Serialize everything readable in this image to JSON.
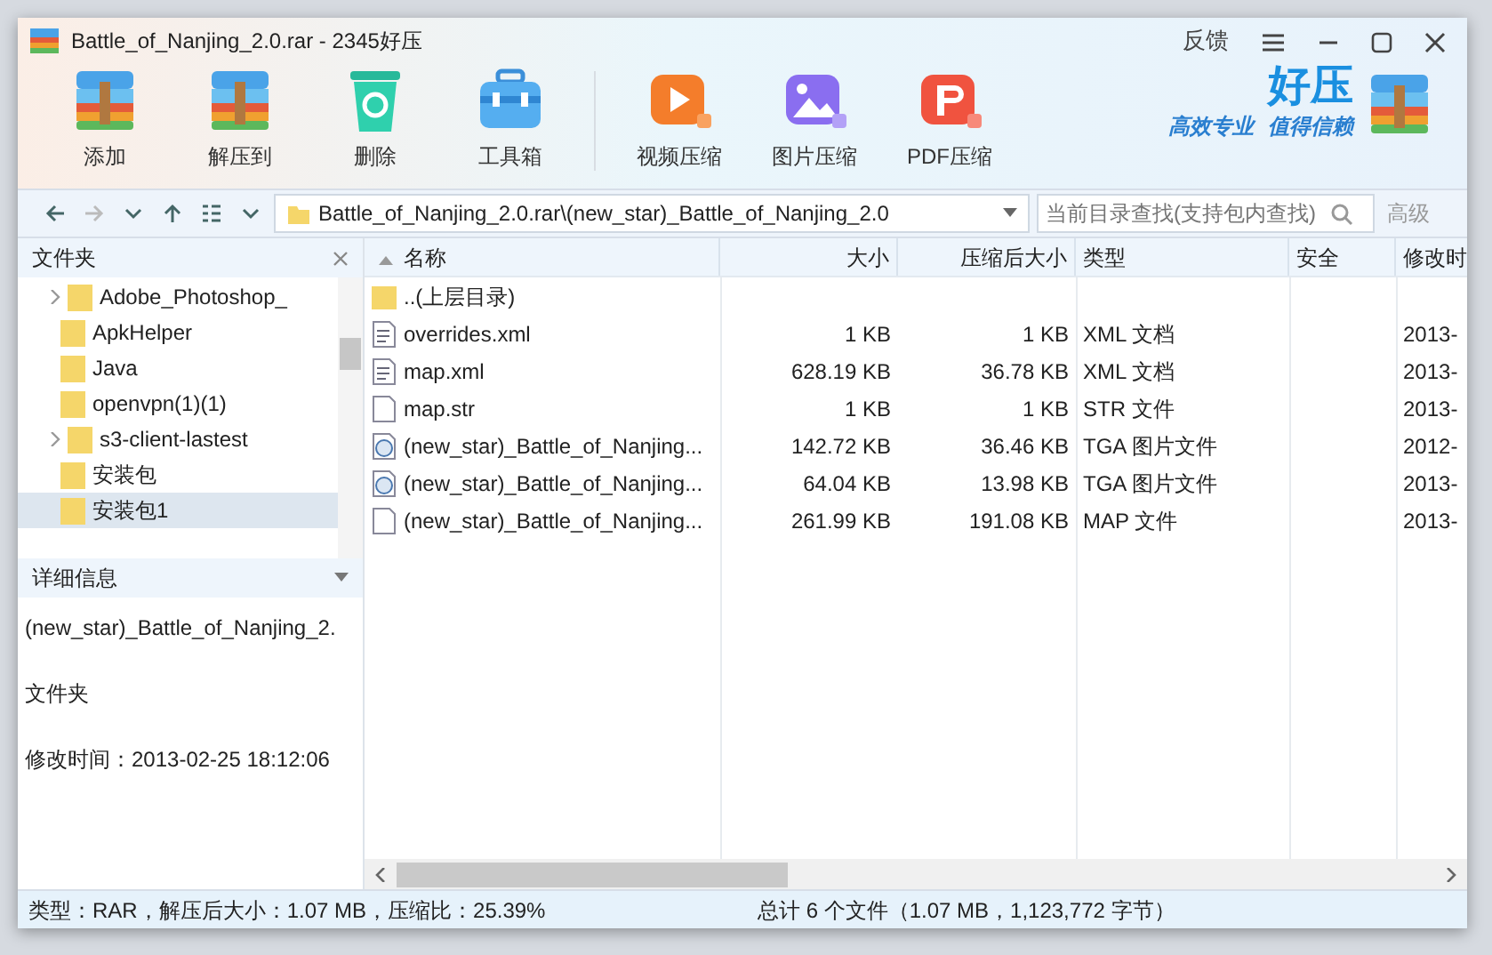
{
  "window": {
    "title": "Battle_of_Nanjing_2.0.rar - 2345好压",
    "feedback": "反馈"
  },
  "toolbar": {
    "groups": [
      [
        {
          "label": "添加",
          "kind": "add"
        },
        {
          "label": "解压到",
          "kind": "extract"
        },
        {
          "label": "删除",
          "kind": "delete"
        },
        {
          "label": "工具箱",
          "kind": "toolbox"
        }
      ],
      [
        {
          "label": "视频压缩",
          "kind": "video"
        },
        {
          "label": "图片压缩",
          "kind": "image"
        },
        {
          "label": "PDF压缩",
          "kind": "pdf"
        }
      ]
    ]
  },
  "logo": {
    "title": "好压",
    "slogan_1": "高效专业",
    "slogan_2": "值得信赖"
  },
  "address_bar": {
    "path": "Battle_of_Nanjing_2.0.rar\\(new_star)_Battle_of_Nanjing_2.0",
    "search_placeholder": "当前目录查找(支持包内查找)",
    "advanced": "高级"
  },
  "folder_panel": {
    "title": "文件夹",
    "items": [
      {
        "label": "Adobe_Photoshop_",
        "expandable": true,
        "selected": false
      },
      {
        "label": "ApkHelper",
        "expandable": false,
        "selected": false
      },
      {
        "label": "Java",
        "expandable": false,
        "selected": false
      },
      {
        "label": "openvpn(1)(1)",
        "expandable": false,
        "selected": false
      },
      {
        "label": "s3-client-lastest",
        "expandable": true,
        "selected": false
      },
      {
        "label": "安装包",
        "expandable": false,
        "selected": false
      },
      {
        "label": "安装包1",
        "expandable": false,
        "selected": true
      }
    ]
  },
  "details_panel": {
    "title": "详细信息",
    "name": "(new_star)_Battle_of_Nanjing_2.",
    "type": "文件夹",
    "modified": "修改时间：2013-02-25 18:12:06"
  },
  "table": {
    "columns": [
      {
        "label": "名称",
        "sorted": true
      },
      {
        "label": "大小",
        "sorted": false
      },
      {
        "label": "压缩后大小",
        "sorted": false
      },
      {
        "label": "类型",
        "sorted": false
      },
      {
        "label": "安全",
        "sorted": false
      },
      {
        "label": "修改时",
        "sorted": false
      }
    ],
    "rows": [
      {
        "kind": "folder",
        "name": "..(上层目录)",
        "size": "",
        "packed": "",
        "type": "",
        "modified": ""
      },
      {
        "kind": "xml",
        "name": "overrides.xml",
        "size": "1 KB",
        "packed": "1 KB",
        "type": "XML 文档",
        "modified": "2013-"
      },
      {
        "kind": "xml",
        "name": "map.xml",
        "size": "628.19 KB",
        "packed": "36.78 KB",
        "type": "XML 文档",
        "modified": "2013-"
      },
      {
        "kind": "file",
        "name": "map.str",
        "size": "1 KB",
        "packed": "1 KB",
        "type": "STR 文件",
        "modified": "2013-"
      },
      {
        "kind": "tga",
        "name": "(new_star)_Battle_of_Nanjing...",
        "size": "142.72 KB",
        "packed": "36.46 KB",
        "type": "TGA 图片文件",
        "modified": "2012-"
      },
      {
        "kind": "tga",
        "name": "(new_star)_Battle_of_Nanjing...",
        "size": "64.04 KB",
        "packed": "13.98 KB",
        "type": "TGA 图片文件",
        "modified": "2013-"
      },
      {
        "kind": "file",
        "name": "(new_star)_Battle_of_Nanjing...",
        "size": "261.99 KB",
        "packed": "191.08 KB",
        "type": "MAP 文件",
        "modified": "2013-"
      }
    ]
  },
  "status_bar": {
    "left": "类型：RAR，解压后大小：1.07 MB，压缩比：25.39%",
    "right": "总计 6 个文件（1.07 MB，1,123,772 字节）"
  }
}
